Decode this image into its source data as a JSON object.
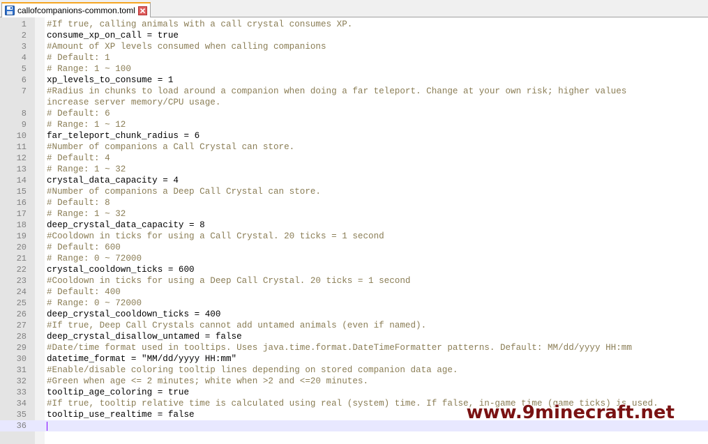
{
  "tab": {
    "label": "callofcompanions-common.toml",
    "icon": "save-file-icon",
    "close_icon": "close-icon",
    "accent": "#f5a623"
  },
  "editor": {
    "comment_color": "#8a7d55",
    "text_color": "#000000",
    "current_line_color": "#e8e8ff",
    "lines": [
      {
        "n": "1",
        "text": "#If true, calling animals with a call crystal consumes XP.",
        "comment": true
      },
      {
        "n": "2",
        "text": "consume_xp_on_call = true",
        "comment": false
      },
      {
        "n": "3",
        "text": "#Amount of XP levels consumed when calling companions",
        "comment": true
      },
      {
        "n": "4",
        "text": "# Default: 1",
        "comment": true
      },
      {
        "n": "5",
        "text": "# Range: 1 ~ 100",
        "comment": true
      },
      {
        "n": "6",
        "text": "xp_levels_to_consume = 1",
        "comment": false
      },
      {
        "n": "7",
        "text": "#Radius in chunks to load around a companion when doing a far teleport. Change at your own risk; higher values",
        "comment": true
      },
      {
        "n": "",
        "text": "increase server memory/CPU usage.",
        "comment": true
      },
      {
        "n": "8",
        "text": "# Default: 6",
        "comment": true
      },
      {
        "n": "9",
        "text": "# Range: 1 ~ 12",
        "comment": true
      },
      {
        "n": "10",
        "text": "far_teleport_chunk_radius = 6",
        "comment": false
      },
      {
        "n": "11",
        "text": "#Number of companions a Call Crystal can store.",
        "comment": true
      },
      {
        "n": "12",
        "text": "# Default: 4",
        "comment": true
      },
      {
        "n": "13",
        "text": "# Range: 1 ~ 32",
        "comment": true
      },
      {
        "n": "14",
        "text": "crystal_data_capacity = 4",
        "comment": false
      },
      {
        "n": "15",
        "text": "#Number of companions a Deep Call Crystal can store.",
        "comment": true
      },
      {
        "n": "16",
        "text": "# Default: 8",
        "comment": true
      },
      {
        "n": "17",
        "text": "# Range: 1 ~ 32",
        "comment": true
      },
      {
        "n": "18",
        "text": "deep_crystal_data_capacity = 8",
        "comment": false
      },
      {
        "n": "19",
        "text": "#Cooldown in ticks for using a Call Crystal. 20 ticks = 1 second",
        "comment": true
      },
      {
        "n": "20",
        "text": "# Default: 600",
        "comment": true
      },
      {
        "n": "21",
        "text": "# Range: 0 ~ 72000",
        "comment": true
      },
      {
        "n": "22",
        "text": "crystal_cooldown_ticks = 600",
        "comment": false
      },
      {
        "n": "23",
        "text": "#Cooldown in ticks for using a Deep Call Crystal. 20 ticks = 1 second",
        "comment": true
      },
      {
        "n": "24",
        "text": "# Default: 400",
        "comment": true
      },
      {
        "n": "25",
        "text": "# Range: 0 ~ 72000",
        "comment": true
      },
      {
        "n": "26",
        "text": "deep_crystal_cooldown_ticks = 400",
        "comment": false
      },
      {
        "n": "27",
        "text": "#If true, Deep Call Crystals cannot add untamed animals (even if named).",
        "comment": true
      },
      {
        "n": "28",
        "text": "deep_crystal_disallow_untamed = false",
        "comment": false
      },
      {
        "n": "29",
        "text": "#Date/time format used in tooltips. Uses java.time.format.DateTimeFormatter patterns. Default: MM/dd/yyyy HH:mm",
        "comment": true
      },
      {
        "n": "30",
        "text": "datetime_format = \"MM/dd/yyyy HH:mm\"",
        "comment": false
      },
      {
        "n": "31",
        "text": "#Enable/disable coloring tooltip lines depending on stored companion data age.",
        "comment": true
      },
      {
        "n": "32",
        "text": "#Green when age <= 2 minutes; white when >2 and <=20 minutes.",
        "comment": true
      },
      {
        "n": "33",
        "text": "tooltip_age_coloring = true",
        "comment": false
      },
      {
        "n": "34",
        "text": "#If true, tooltip relative time is calculated using real (system) time. If false, in-game time (game ticks) is used.",
        "comment": true
      },
      {
        "n": "35",
        "text": "tooltip_use_realtime = false",
        "comment": false
      },
      {
        "n": "36",
        "text": "",
        "comment": false,
        "current": true
      }
    ]
  },
  "watermark": {
    "text": "www.9minecraft.net",
    "color": "#7a1212"
  }
}
